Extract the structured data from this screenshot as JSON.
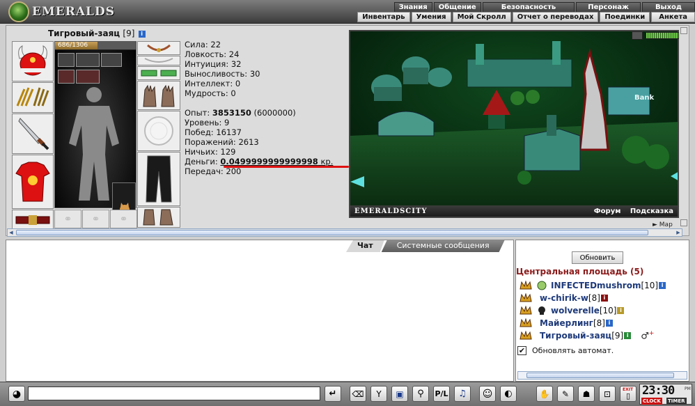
{
  "header": {
    "logo_text": "EMERALDS",
    "menu_top": [
      "Знания",
      "Общение",
      "Безопасность",
      "Персонаж",
      "Выход"
    ],
    "menu_bottom": [
      "Инвентарь",
      "Умения",
      "Мой Скролл",
      "Отчет о переводах",
      "Поединки",
      "Анкета"
    ]
  },
  "character": {
    "name": "Тигровый-заяц",
    "level": "[9]",
    "hp": "686/1306",
    "hp_fraction": 0.525
  },
  "stats": {
    "strength": "Сила: 22",
    "agility": "Ловкость: 24",
    "intuition": "Интуиция: 32",
    "endurance": "Выносливость: 30",
    "intellect": "Интеллект: 0",
    "wisdom": "Мудрость: 0",
    "exp_label": "Опыт: ",
    "exp_value": "3853150",
    "exp_next": " (6000000)",
    "level_line": "Уровень: 9",
    "wins": "Побед: 16137",
    "losses": "Поражений: 2613",
    "draws": "Ничьих: 129",
    "money_label": "Деньги: ",
    "money_value": "0.0499999999999998",
    "money_unit": " кр.",
    "transfers": "Передач: 200"
  },
  "scene": {
    "city_name": "EMERALDSCITY",
    "bank_sign": "Bank",
    "links": [
      "Форум",
      "Подсказка"
    ],
    "map_link": "► Map"
  },
  "chat": {
    "tabs": [
      "Чат",
      "Системные сообщения"
    ]
  },
  "users_panel": {
    "refresh_label": "Обновить",
    "room_title": "Центральная площадь (5)",
    "users": [
      {
        "name": "INFECTEDmushrom",
        "level": "[10]"
      },
      {
        "name": "w-chirik-w",
        "level": "[8]"
      },
      {
        "name": "wolverelle",
        "level": "[10]"
      },
      {
        "name": "Майерлинг",
        "level": "[8]"
      },
      {
        "name": "Тигровый-заяц",
        "level": "[9]"
      }
    ],
    "auto_refresh_label": "Обновлять автомат.",
    "auto_refresh_checked": "✔"
  },
  "toolbar": {
    "time": "23:30",
    "pm": "PM",
    "clock_label": "CLOCK",
    "timer_label": "TIMER",
    "exit_label": "EXIT"
  },
  "colors": {
    "room_title": "#8b1a1a",
    "user_name": "#1e3a7a",
    "money_underline": "#e01111",
    "scene_bg": "#0e3a14"
  }
}
